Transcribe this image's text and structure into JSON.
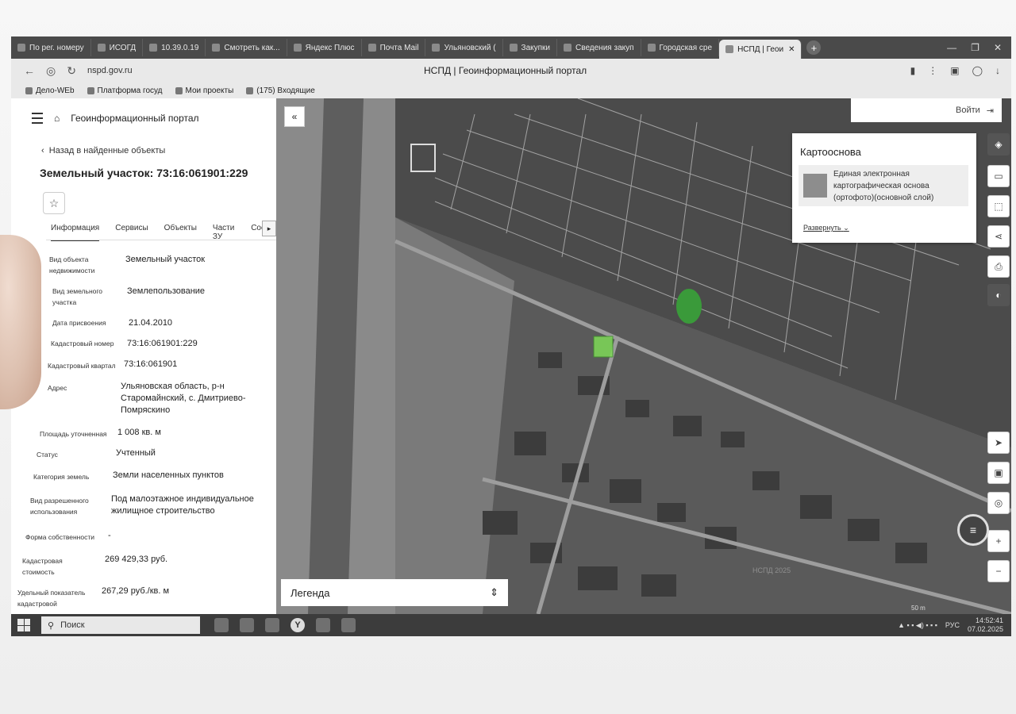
{
  "browser": {
    "tabs": [
      "По рег. номеру",
      "ИСОГД",
      "10.39.0.19",
      "Смотреть как...",
      "Яндекс Плюс",
      "Почта Mail",
      "Ульяновский (",
      "Закупки",
      "Сведения закуп",
      "Городская сре",
      "НСПД | Геои"
    ],
    "url": "nspd.gov.ru",
    "page_title": "НСПД | Геоинформационный портал",
    "bookmarks": [
      "Дело-WEb",
      "Платформа госуд",
      "Мои проекты",
      "(175) Входящие"
    ]
  },
  "panel": {
    "portal_title": "Геоинформационный портал",
    "back_link": "Назад в найденные объекты",
    "object_title": "Земельный участок: 73:16:061901:229",
    "tabs": [
      "Информация",
      "Сервисы",
      "Объекты",
      "Части ЗУ",
      "Соста"
    ],
    "props": [
      {
        "label": "Вид объекта недвижимости",
        "value": "Земельный участок"
      },
      {
        "label": "Вид земельного участка",
        "value": "Землепользование"
      },
      {
        "label": "Дата присвоения",
        "value": "21.04.2010"
      },
      {
        "label": "Кадастровый номер",
        "value": "73:16:061901:229"
      },
      {
        "label": "Кадастровый квартал",
        "value": "73:16:061901"
      },
      {
        "label": "Адрес",
        "value": "Ульяновская область, р-н Старомайнский, с. Дмитриево-Помряскино"
      },
      {
        "label": "Площадь уточненная",
        "value": "1 008 кв. м"
      },
      {
        "label": "Статус",
        "value": "Учтенный"
      },
      {
        "label": "Категория земель",
        "value": "Земли населенных пунктов"
      },
      {
        "label": "Вид разрешенного использования",
        "value": "Под малоэтажное индивидуальное жилищное строительство"
      },
      {
        "label": "Форма собственности",
        "value": "-"
      },
      {
        "label": "Кадастровая стоимость",
        "value": "269 429,33 руб."
      },
      {
        "label": "Удельный показатель кадастровой",
        "value": "267,29 руб./кв. м"
      }
    ]
  },
  "map": {
    "login_label": "Войти",
    "basemap_title": "Картооснова",
    "basemap_layer": "Единая электронная картографическая основа (ортофото)(основной слой)",
    "expand_label": "Развернуть",
    "legend_label": "Легенда",
    "attribution": "НСПД 2025",
    "scale": "50 m"
  },
  "taskbar": {
    "search_placeholder": "Поиск",
    "lang": "РУС",
    "time": "14:52:41",
    "date": "07.02.2025"
  }
}
